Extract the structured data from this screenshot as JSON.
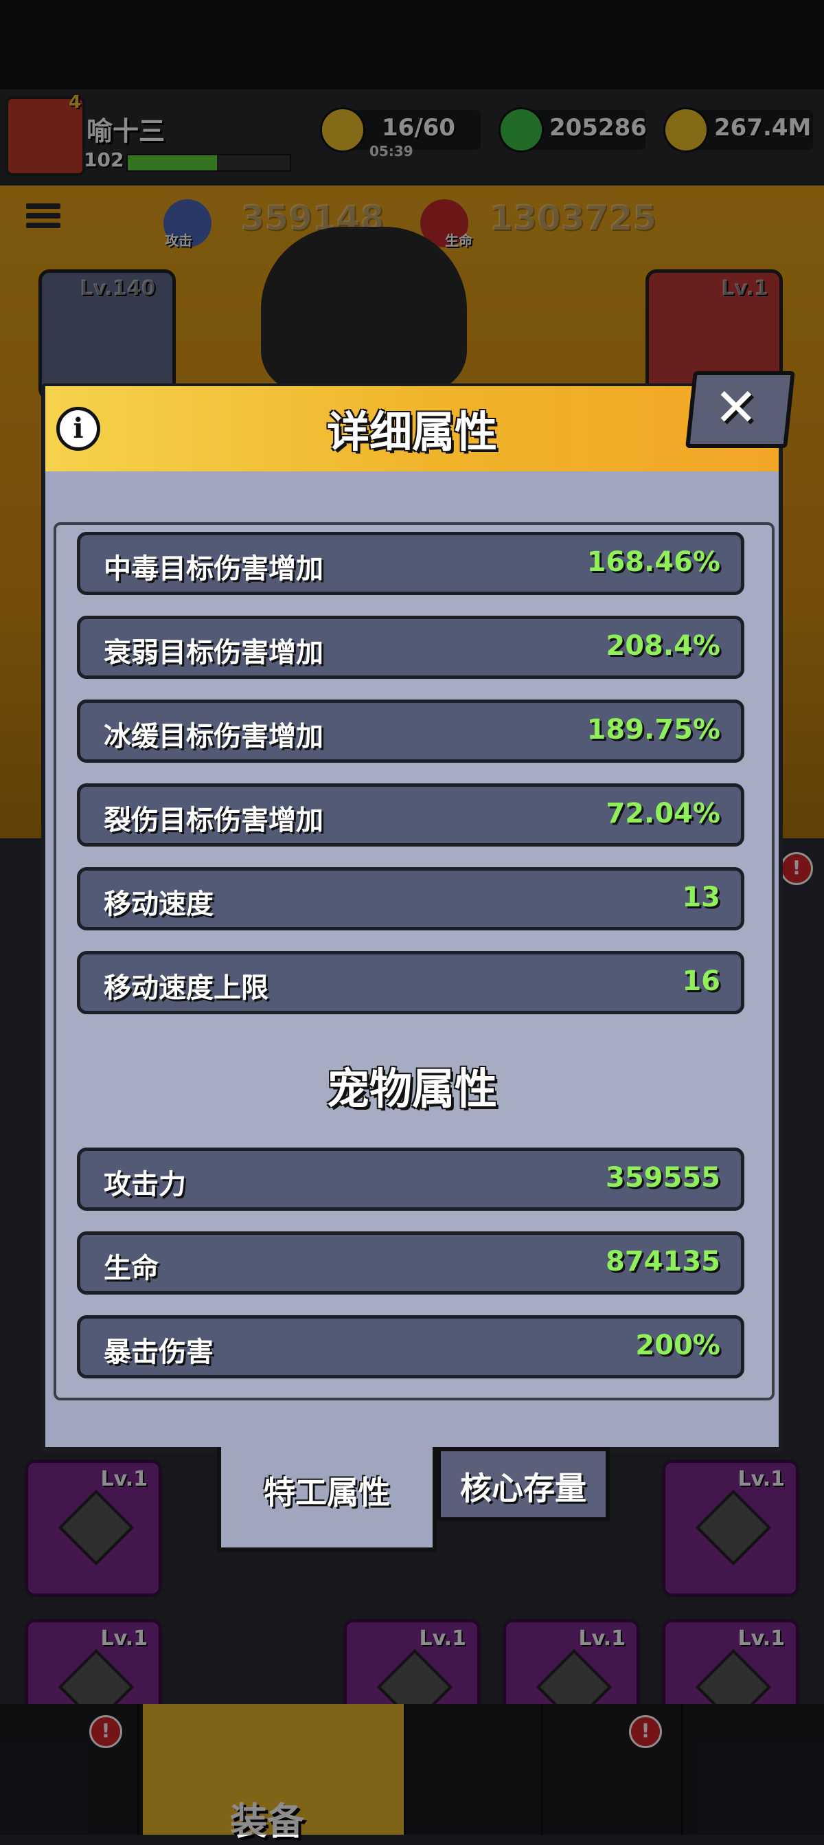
{
  "player": {
    "name": "喻十三",
    "level": "102",
    "vip_level": "4",
    "xp_fraction": 0.55
  },
  "resources": {
    "energy": "16/60",
    "energy_timer": "05:39",
    "gems": "205286",
    "gold": "267.4M"
  },
  "hero_stats": {
    "attack_label": "攻击",
    "attack_value": "359148",
    "hp_label": "生命",
    "hp_value": "1303725"
  },
  "side_cards": {
    "left_level": "Lv.140",
    "right_level": "Lv.1"
  },
  "inventory": {
    "item_level": "Lv.1"
  },
  "nav": {
    "equip_label": "装备",
    "badge": "!"
  },
  "modal": {
    "title": "详细属性",
    "close_label": "✕",
    "info_label": "i",
    "stats": [
      {
        "name": "中毒目标伤害增加",
        "value": "168.46%"
      },
      {
        "name": "衰弱目标伤害增加",
        "value": "208.4%"
      },
      {
        "name": "冰缓目标伤害增加",
        "value": "189.75%"
      },
      {
        "name": "裂伤目标伤害增加",
        "value": "72.04%"
      },
      {
        "name": "移动速度",
        "value": "13"
      },
      {
        "name": "移动速度上限",
        "value": "16"
      }
    ],
    "pet_section_title": "宠物属性",
    "pet_stats": [
      {
        "name": "攻击力",
        "value": "359555"
      },
      {
        "name": "生命",
        "value": "874135"
      },
      {
        "name": "暴击伤害",
        "value": "200%"
      }
    ],
    "tabs": {
      "active": "特工属性",
      "inactive": "核心存量"
    }
  },
  "colors": {
    "value_green": "#8ff05a",
    "header_yellow": "#f0b32a",
    "row_bg": "#525a75"
  }
}
